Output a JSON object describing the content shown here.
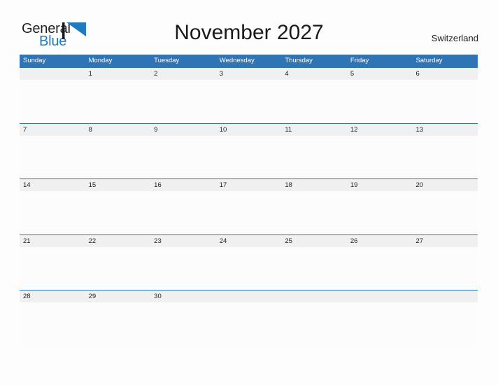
{
  "brand": {
    "name_part1": "General",
    "name_part2": "Blue",
    "mark_icon": "triangle-mark-icon",
    "color_dark": "#231f20",
    "color_blue": "#1f7bc1"
  },
  "header": {
    "title": "November 2027",
    "region": "Switzerland"
  },
  "calendar": {
    "month": "November",
    "year": "2027",
    "accent_color": "#2f75b5",
    "band_color": "#f0f0f0",
    "weekdays": [
      "Sunday",
      "Monday",
      "Tuesday",
      "Wednesday",
      "Thursday",
      "Friday",
      "Saturday"
    ],
    "weeks": [
      {
        "days": [
          "",
          "1",
          "2",
          "3",
          "4",
          "5",
          "6"
        ]
      },
      {
        "days": [
          "7",
          "8",
          "9",
          "10",
          "11",
          "12",
          "13"
        ]
      },
      {
        "days": [
          "14",
          "15",
          "16",
          "17",
          "18",
          "19",
          "20"
        ]
      },
      {
        "days": [
          "21",
          "22",
          "23",
          "24",
          "25",
          "26",
          "27"
        ]
      },
      {
        "days": [
          "28",
          "29",
          "30",
          "",
          "",
          "",
          ""
        ]
      }
    ]
  }
}
